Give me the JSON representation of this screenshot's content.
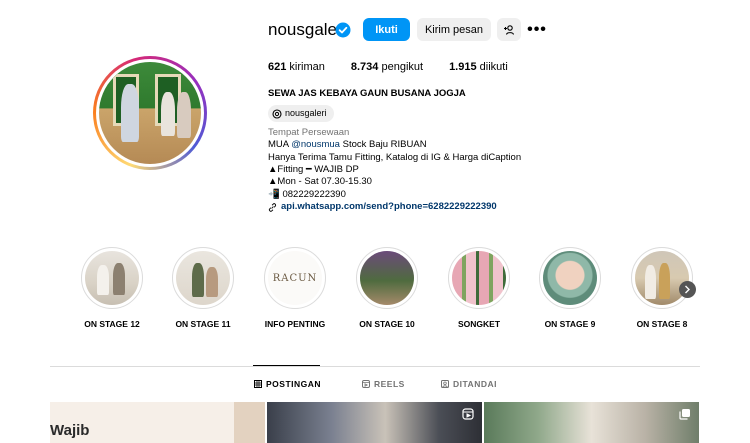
{
  "profile": {
    "username": "nousgaleri",
    "follow_label": "Ikuti",
    "message_label": "Kirim pesan",
    "more_glyph": "•••"
  },
  "stats": {
    "posts_count": "621",
    "posts_label": "kiriman",
    "followers_count": "8.734",
    "followers_label": "pengikut",
    "following_count": "1.915",
    "following_label": "diikuti"
  },
  "bio": {
    "name": "SEWA JAS KEBAYA GAUN BUSANA JOGJA",
    "threads_handle": "nousgaleri",
    "category": "Tempat Persewaan",
    "line1_prefix": "MUA ",
    "line1_mention": "@nousmua",
    "line1_suffix": " Stock Baju RIBUAN",
    "line2": "Hanya Terima Tamu Fitting, Katalog di IG & Harga diCaption",
    "line3": "▲Fitting ━ WAJIB DP",
    "line4": "▲Mon - Sat 07.30-15.30",
    "line5": "📲 082229222390",
    "link": "api.whatsapp.com/send?phone=6282229222390"
  },
  "highlights": [
    {
      "label": "ON STAGE 12"
    },
    {
      "label": "ON STAGE 11"
    },
    {
      "label": "INFO PENTING",
      "logo_text": "RACUN"
    },
    {
      "label": "ON STAGE 10"
    },
    {
      "label": "SONGKET"
    },
    {
      "label": "ON STAGE 9"
    },
    {
      "label": "ON STAGE 8"
    }
  ],
  "tabs": {
    "posts": "POSTINGAN",
    "reels": "REELS",
    "tagged": "DITANDAI"
  },
  "posts": {
    "first_caption": "Wajib"
  },
  "colors": {
    "accent": "#0095f6",
    "link": "#00376b",
    "muted": "#737373"
  }
}
